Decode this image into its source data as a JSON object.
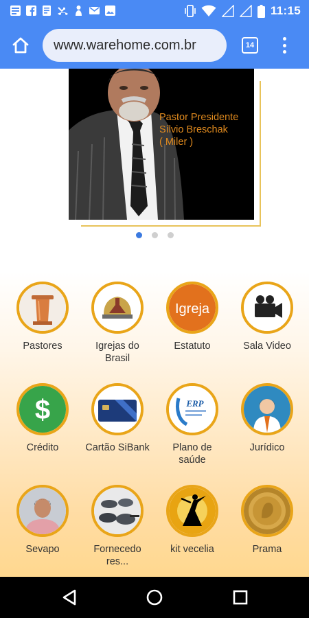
{
  "status_bar": {
    "time": "11:15"
  },
  "browser": {
    "url": "www.warehome.com.br",
    "tab_count": "14"
  },
  "banner": {
    "line1": "Pastor Presidente",
    "line2": "Sílvio Breschak",
    "line3": "( Miler )",
    "dots_total": 3,
    "dot_active_index": 0
  },
  "tiles": [
    {
      "label": "Pastores",
      "icon": "pulpit-icon"
    },
    {
      "label": "Igrejas do Brasil",
      "icon": "church-emblem-icon"
    },
    {
      "label": "Estatuto",
      "icon": "igreja-logo-icon",
      "icon_text": "Igreja"
    },
    {
      "label": "Sala Video",
      "icon": "video-camera-icon"
    },
    {
      "label": "Crédito",
      "icon": "dollar-icon"
    },
    {
      "label": "Cartão SiBank",
      "icon": "card-icon"
    },
    {
      "label": "Plano de saúde",
      "icon": "health-plan-icon",
      "icon_text": "ERP"
    },
    {
      "label": "Jurídico",
      "icon": "lawyer-icon"
    },
    {
      "label": "Sevapo",
      "icon": "person-photo-icon"
    },
    {
      "label": "Fornecedo res...",
      "icon": "cookware-icon"
    },
    {
      "label": "kit vecelia",
      "icon": "dancer-icon"
    },
    {
      "label": "Prama",
      "icon": "gold-coin-icon"
    }
  ],
  "colors": {
    "status_bar": "#4a8af4",
    "tile_ring": "#e9a519",
    "banner_text": "#e08a1e",
    "dot_active": "#3b7ae0"
  }
}
